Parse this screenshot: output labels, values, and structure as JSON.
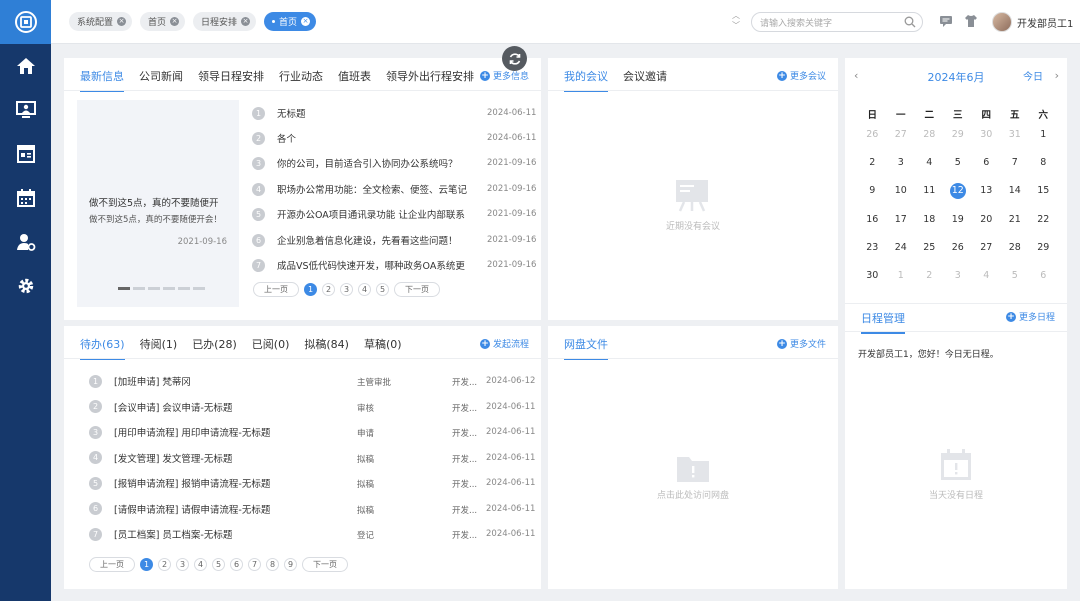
{
  "header": {
    "tabs": [
      {
        "label": "系统配置",
        "active": false
      },
      {
        "label": "首页",
        "active": false
      },
      {
        "label": "日程安排",
        "active": false
      },
      {
        "label": "首页",
        "active": true
      }
    ],
    "search_placeholder": "请输入搜索关键字",
    "username": "开发部员工1"
  },
  "sidebar": {
    "items": [
      "home-icon",
      "monitor-icon",
      "news-icon",
      "calendar-icon",
      "user-settings-icon",
      "gear-icon"
    ]
  },
  "news": {
    "tabs": [
      "最新信息",
      "公司新闻",
      "领导日程安排",
      "行业动态",
      "值班表",
      "领导外出行程安排"
    ],
    "more": "更多信息",
    "featured": {
      "title": "做不到这5点，真的不要随便开",
      "subtitle": "做不到这5点，真的不要随便开会！",
      "date": "2021-09-16"
    },
    "items": [
      {
        "n": "1",
        "title": "无标题",
        "date": "2024-06-11"
      },
      {
        "n": "2",
        "title": "各个",
        "date": "2024-06-11"
      },
      {
        "n": "3",
        "title": "你的公司，目前适合引入协同办公系统吗？",
        "date": "2021-09-16"
      },
      {
        "n": "4",
        "title": "职场办公常用功能：全文检索、便签、云笔记",
        "date": "2021-09-16"
      },
      {
        "n": "5",
        "title": "开源办公OA项目通讯录功能 让企业内部联系",
        "date": "2021-09-16"
      },
      {
        "n": "6",
        "title": "企业别急着信息化建设，先看看这些问题！",
        "date": "2021-09-16"
      },
      {
        "n": "7",
        "title": "成品VS低代码快速开发，哪种政务OA系统更",
        "date": "2021-09-16"
      }
    ],
    "pager": {
      "prev": "上一页",
      "next": "下一页",
      "pages": [
        "1",
        "2",
        "3",
        "4",
        "5"
      ],
      "current": "1"
    }
  },
  "meeting": {
    "tabs": [
      "我的会议",
      "会议邀请"
    ],
    "more": "更多会议",
    "empty": "近期没有会议"
  },
  "calendar": {
    "title": "2024年6月",
    "today_label": "今日",
    "weekdays": [
      "日",
      "一",
      "二",
      "三",
      "四",
      "五",
      "六"
    ],
    "weeks": [
      [
        "26",
        "27",
        "28",
        "29",
        "30",
        "31",
        "1"
      ],
      [
        "2",
        "3",
        "4",
        "5",
        "6",
        "7",
        "8"
      ],
      [
        "9",
        "10",
        "11",
        "12",
        "13",
        "14",
        "15"
      ],
      [
        "16",
        "17",
        "18",
        "19",
        "20",
        "21",
        "22"
      ],
      [
        "23",
        "24",
        "25",
        "26",
        "27",
        "28",
        "29"
      ],
      [
        "30",
        "1",
        "2",
        "3",
        "4",
        "5",
        "6"
      ]
    ],
    "today": "12"
  },
  "schedule": {
    "tab": "日程管理",
    "more": "更多日程",
    "message": "开发部员工1，您好！今日无日程。",
    "empty": "当天没有日程"
  },
  "workflow": {
    "tabs": [
      "待办(63)",
      "待阅(1)",
      "已办(28)",
      "已阅(0)",
      "拟稿(84)",
      "草稿(0)"
    ],
    "more": "发起流程",
    "items": [
      {
        "n": "1",
        "title": "[加班申请] 梵蒂冈",
        "step": "主管审批",
        "who": "开发...",
        "date": "2024-06-12"
      },
      {
        "n": "2",
        "title": "[会议申请] 会议申请-无标题",
        "step": "审核",
        "who": "开发...",
        "date": "2024-06-11"
      },
      {
        "n": "3",
        "title": "[用印申请流程] 用印申请流程-无标题",
        "step": "申请",
        "who": "开发...",
        "date": "2024-06-11"
      },
      {
        "n": "4",
        "title": "[发文管理] 发文管理-无标题",
        "step": "拟稿",
        "who": "开发...",
        "date": "2024-06-11"
      },
      {
        "n": "5",
        "title": "[报销申请流程] 报销申请流程-无标题",
        "step": "拟稿",
        "who": "开发...",
        "date": "2024-06-11"
      },
      {
        "n": "6",
        "title": "[请假申请流程] 请假申请流程-无标题",
        "step": "拟稿",
        "who": "开发...",
        "date": "2024-06-11"
      },
      {
        "n": "7",
        "title": "[员工档案] 员工档案-无标题",
        "step": "登记",
        "who": "开发...",
        "date": "2024-06-11"
      }
    ],
    "pager": {
      "prev": "上一页",
      "next": "下一页",
      "pages": [
        "1",
        "2",
        "3",
        "4",
        "5",
        "6",
        "7",
        "8",
        "9"
      ],
      "current": "1"
    }
  },
  "disk": {
    "tab": "网盘文件",
    "more": "更多文件",
    "empty": "点击此处访问网盘"
  }
}
